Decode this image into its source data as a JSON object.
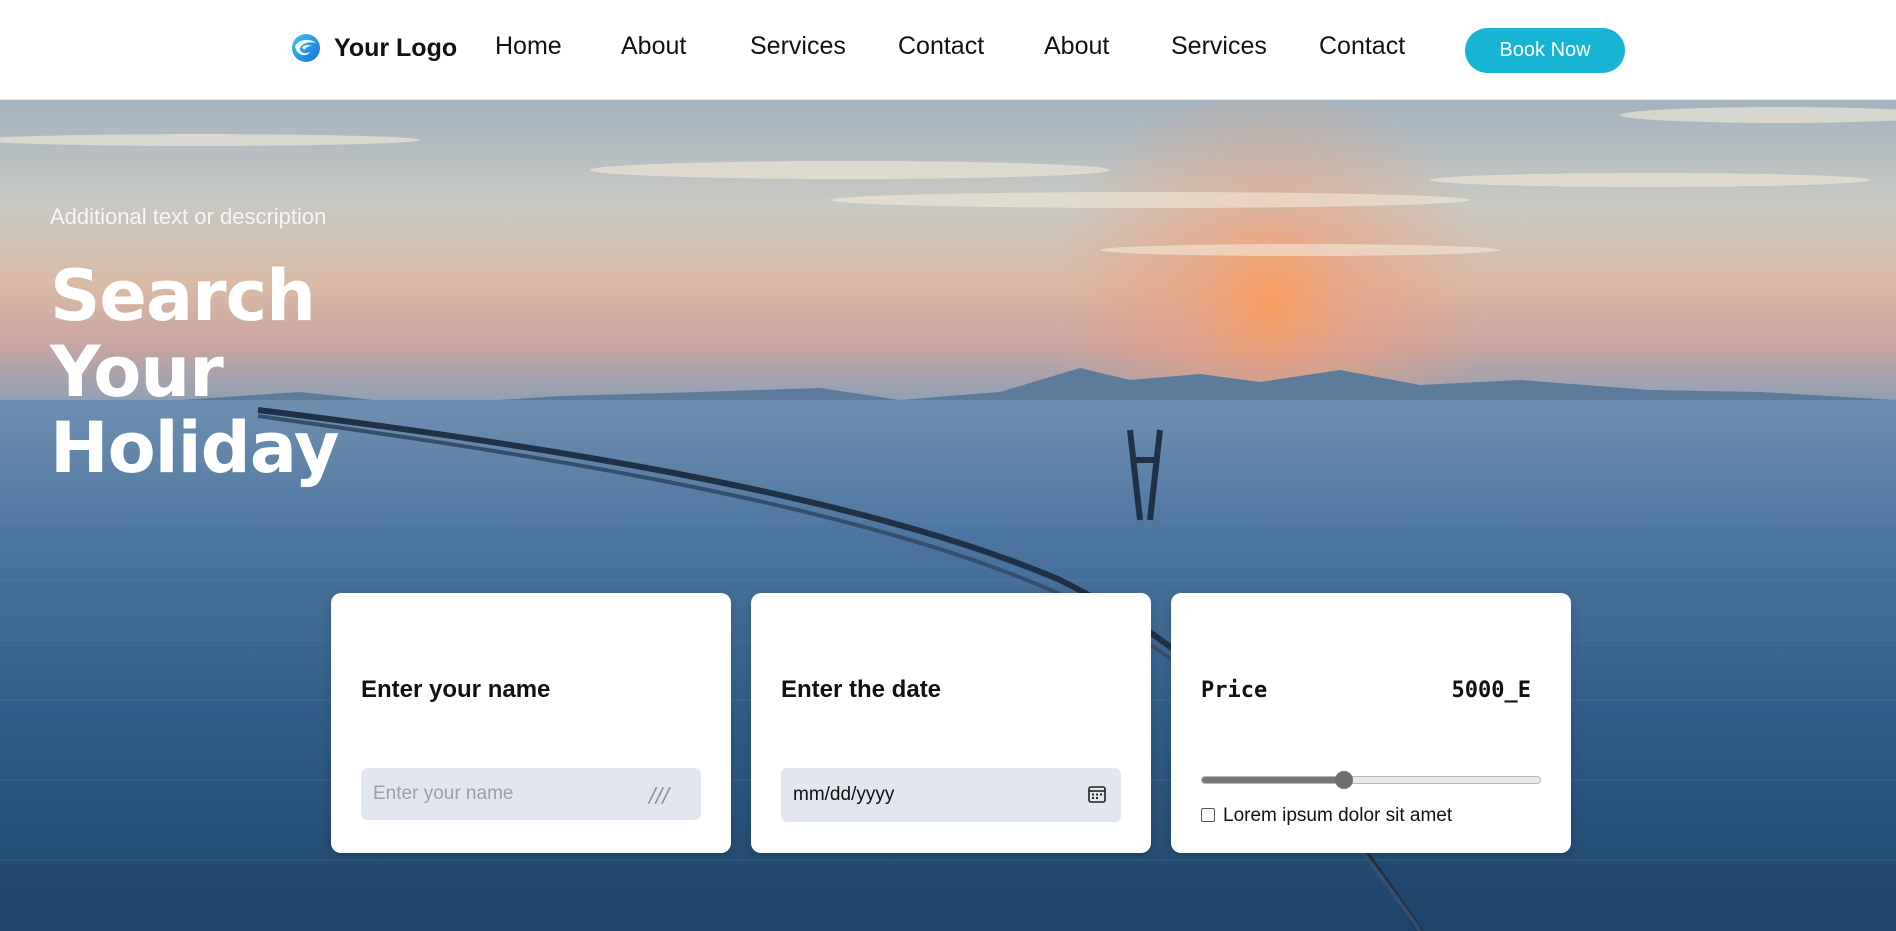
{
  "header": {
    "logo_text": "Your Logo",
    "nav": [
      "Home",
      "About",
      "Services",
      "Contact",
      "About",
      "Services",
      "Contact"
    ],
    "cta_label": "Book Now"
  },
  "hero": {
    "subtitle": "Additional text or description",
    "title": "Search Your Holiday"
  },
  "cards": {
    "name": {
      "label": "Enter your name",
      "placeholder": "Enter your name",
      "suffix": "///"
    },
    "date": {
      "label": "Enter the date",
      "value": "mm/dd/yyyy"
    },
    "price": {
      "label": "Price",
      "value": "5000_E",
      "slider_fraction": 0.42,
      "checkbox_label": "Lorem ipsum dolor sit amet",
      "checked": false
    }
  },
  "colors": {
    "accent": "#18b4d4"
  },
  "icons": {
    "logo": "swirl-logo-icon",
    "calendar": "calendar-icon"
  }
}
